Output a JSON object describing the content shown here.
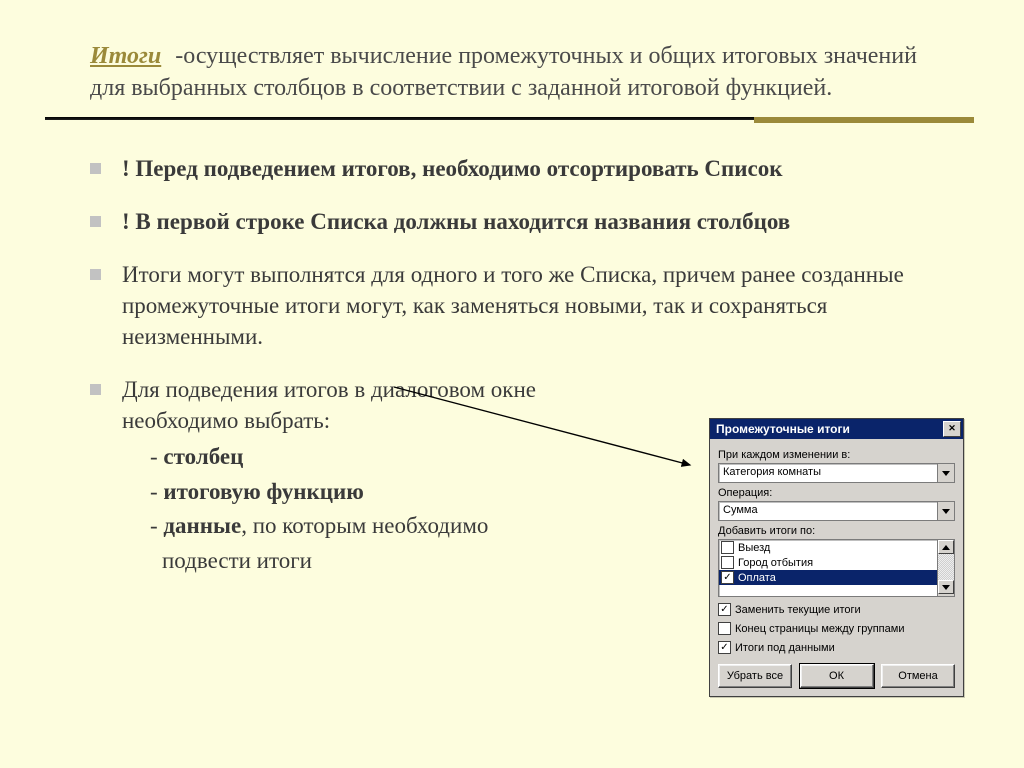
{
  "title": {
    "term": "Итоги",
    "rest": " -осуществляет вычисление промежуточных и общих итоговых значений для выбранных столбцов   в соответствии с заданной итоговой функцией."
  },
  "bullets": {
    "b1": "! Перед подведением итогов, необходимо отсортировать Список",
    "b2": "! В первой строке Списка должны находится названия столбцов",
    "b3": "Итоги могут выполнятся для одного и того же Списка, причем ранее созданные промежуточные итоги могут, как заменяться новыми, так и сохраняться неизменными.",
    "b4_lead": "Для подведения итогов в диалоговом окне",
    "b4_lead2": "необходимо выбрать:",
    "b4_s1_pre": "- ",
    "b4_s1": "столбец",
    "b4_s2_pre": "-  ",
    "b4_s2": "итоговую функцию",
    "b4_s3_pre": "- ",
    "b4_s3_bold": "данные",
    "b4_s3_rest": ", по которым необходимо",
    "b4_s3_line2": "подвести итоги"
  },
  "dialog": {
    "title": "Промежуточные итоги",
    "label1": "При каждом изменении в:",
    "select1": "Категория комнаты",
    "label2": "Операция:",
    "select2": "Сумма",
    "label3": "Добавить итоги по:",
    "list": {
      "i1": "Выезд",
      "i2": "Город отбытия",
      "i3": "Оплата"
    },
    "chk1": "Заменить текущие итоги",
    "chk2": "Конец страницы между группами",
    "chk3": "Итоги под данными",
    "btn_remove": "Убрать все",
    "btn_ok": "ОК",
    "btn_cancel": "Отмена"
  }
}
